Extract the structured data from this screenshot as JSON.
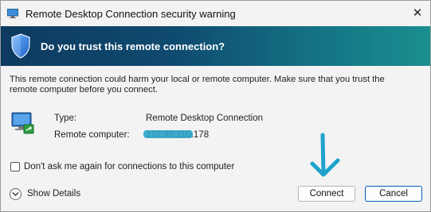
{
  "window": {
    "title": "Remote Desktop Connection security warning",
    "close_glyph": "✕"
  },
  "banner": {
    "heading": "Do you trust this remote connection?"
  },
  "warning_text": "This remote connection could harm your local or remote computer. Make sure that you trust the remote computer before you connect.",
  "details": {
    "type_label": "Type:",
    "type_value": "Remote Desktop Connection",
    "remote_label": "Remote computer:",
    "remote_value": "172.30.110.178"
  },
  "checkbox": {
    "label": "Don't ask me again for connections to this computer",
    "checked": false
  },
  "show_details_label": "Show Details",
  "buttons": {
    "connect": "Connect",
    "cancel": "Cancel"
  },
  "icons": [
    "rdp-app-icon",
    "shield-icon",
    "remote-computer-icon",
    "chevron-down-icon",
    "close-icon"
  ],
  "colors": {
    "banner_start": "#0d3a5f",
    "banner_end": "#1a8f90",
    "annotation_arrow": "#1ea2cc",
    "focus_border": "#005fb8"
  }
}
